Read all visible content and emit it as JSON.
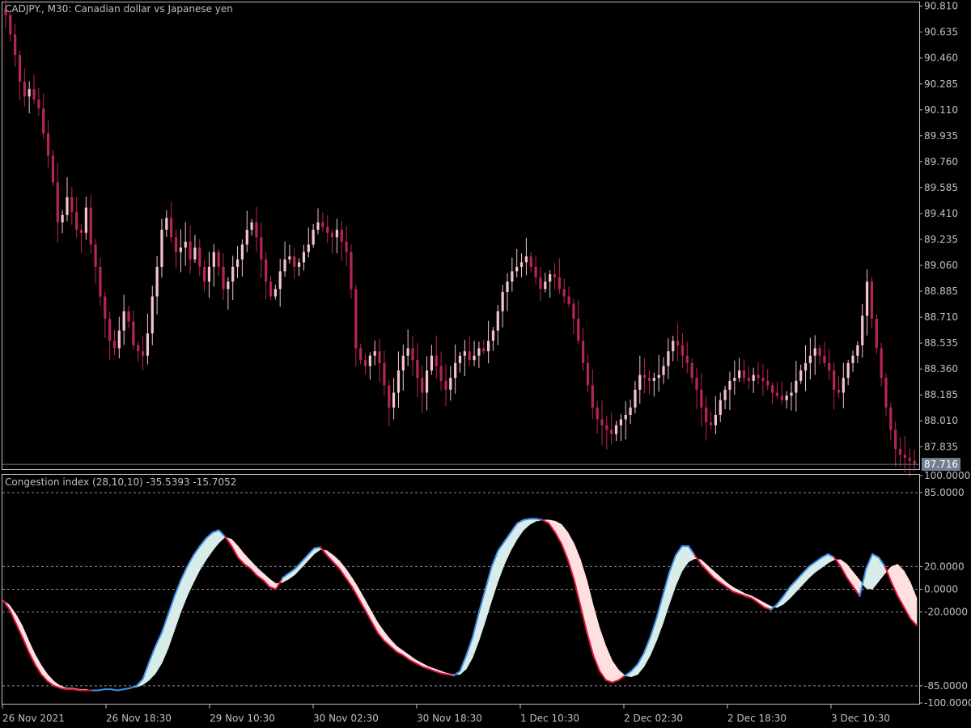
{
  "colors": {
    "background": "#000000",
    "axis_line": "#c0c0c0",
    "text": "#c0c0c0",
    "bull_candle": "#f2c5cc",
    "bear_candle": "#b8264f",
    "grid_dash": "#c0c0c0",
    "current_price_line": "#6f7f9f",
    "current_price_label_bg": "#708090",
    "up_line": "#3f8fe6",
    "down_line": "#dc143c",
    "up_fill": "#d8ece9",
    "down_fill": "#ffe0e0"
  },
  "price_panel": {
    "symbol_label": "CADJPY., M30:  Canadian dollar vs Japanese yen",
    "current_price": "87.716",
    "ticks": [
      "90.810",
      "90.635",
      "90.460",
      "90.285",
      "90.110",
      "89.935",
      "89.760",
      "89.585",
      "89.410",
      "89.235",
      "89.060",
      "88.885",
      "88.710",
      "88.535",
      "88.360",
      "88.185",
      "88.010",
      "87.835"
    ]
  },
  "indicator_panel": {
    "label": "Congestion index (28,10,10) -35.5393 -15.7052",
    "ticks": [
      "100.0000",
      "85.0000",
      "20.0000",
      "0.0000",
      "-20.0000",
      "-85.0000",
      "-100.0000"
    ],
    "levels": [
      "85.0000",
      "20.0000",
      "0.0000",
      "-20.0000",
      "-85.0000"
    ]
  },
  "time_axis": {
    "labels": [
      "26 Nov 2021",
      "26 Nov 18:30",
      "29 Nov 10:30",
      "30 Nov 02:30",
      "30 Nov 18:30",
      "1 Dec 10:30",
      "2 Dec 02:30",
      "2 Dec 18:30",
      "3 Dec 10:30"
    ]
  },
  "chart_data": [
    {
      "type": "candlestick",
      "title": "CADJPY., M30:  Canadian dollar vs Japanese yen",
      "ylim": [
        87.7,
        90.83
      ],
      "x_start_label": "26 Nov 2021",
      "closes": [
        90.75,
        90.62,
        90.48,
        90.3,
        90.2,
        90.25,
        90.18,
        90.12,
        89.95,
        89.8,
        89.62,
        89.35,
        89.4,
        89.52,
        89.42,
        89.3,
        89.28,
        89.45,
        89.2,
        89.05,
        88.85,
        88.7,
        88.55,
        88.5,
        88.62,
        88.75,
        88.68,
        88.52,
        88.48,
        88.45,
        88.6,
        88.85,
        89.05,
        89.3,
        89.38,
        89.25,
        89.15,
        89.18,
        89.22,
        89.1,
        89.18,
        89.05,
        88.95,
        89.05,
        89.15,
        89.05,
        88.9,
        88.95,
        89.05,
        89.1,
        89.2,
        89.3,
        89.35,
        89.25,
        89.1,
        88.95,
        88.85,
        88.9,
        89.02,
        89.1,
        89.12,
        89.05,
        89.08,
        89.15,
        89.2,
        89.3,
        89.35,
        89.32,
        89.28,
        89.25,
        89.3,
        89.22,
        89.15,
        88.9,
        88.5,
        88.42,
        88.38,
        88.45,
        88.48,
        88.4,
        88.25,
        88.1,
        88.2,
        88.35,
        88.45,
        88.5,
        88.42,
        88.3,
        88.2,
        88.35,
        88.45,
        88.38,
        88.28,
        88.22,
        88.3,
        88.4,
        88.45,
        88.48,
        88.42,
        88.45,
        88.5,
        88.48,
        88.55,
        88.62,
        88.75,
        88.88,
        88.95,
        89.02,
        89.05,
        89.08,
        89.12,
        89.05,
        88.98,
        88.9,
        88.95,
        89.0,
        88.98,
        88.9,
        88.85,
        88.8,
        88.7,
        88.55,
        88.4,
        88.25,
        88.1,
        88.02,
        87.98,
        87.95,
        87.92,
        87.98,
        88.02,
        88.05,
        88.1,
        88.22,
        88.32,
        88.3,
        88.28,
        88.3,
        88.32,
        88.38,
        88.48,
        88.55,
        88.52,
        88.45,
        88.4,
        88.3,
        88.22,
        88.1,
        88.0,
        87.98,
        88.05,
        88.15,
        88.22,
        88.28,
        88.3,
        88.35,
        88.3,
        88.28,
        88.32,
        88.3,
        88.28,
        88.25,
        88.2,
        88.18,
        88.15,
        88.18,
        88.2,
        88.28,
        88.35,
        88.4,
        88.45,
        88.5,
        88.45,
        88.4,
        88.35,
        88.22,
        88.2,
        88.3,
        88.4,
        88.45,
        88.52,
        88.72,
        88.95,
        88.7,
        88.5,
        88.3,
        88.1,
        87.95,
        87.82,
        87.78,
        87.76,
        87.74,
        87.72
      ]
    },
    {
      "type": "area",
      "title": "Congestion index (28,10,10) -35.5393 -15.7052",
      "ylim": [
        -100,
        100
      ],
      "reference_levels": [
        85,
        20,
        0,
        -20,
        -85
      ],
      "series": [
        {
          "name": "",
          "values": [
            -10,
            -18,
            -30,
            -42,
            -55,
            -66,
            -75,
            -81,
            -85,
            -87,
            -88,
            -88,
            -89,
            -89,
            -89,
            -89,
            -88,
            -88,
            -89,
            -88,
            -87,
            -85,
            -79,
            -64,
            -50,
            -38,
            -22,
            -6,
            8,
            20,
            30,
            38,
            45,
            50,
            52,
            46,
            38,
            28,
            22,
            18,
            12,
            8,
            2,
            0,
            10,
            14,
            18,
            24,
            30,
            36,
            37,
            30,
            24,
            18,
            10,
            2,
            -8,
            -18,
            -28,
            -38,
            -45,
            -50,
            -55,
            -58,
            -62,
            -65,
            -68,
            -70,
            -72,
            -74,
            -75,
            -76,
            -72,
            -58,
            -42,
            -20,
            0,
            20,
            34,
            42,
            50,
            58,
            61,
            62,
            62,
            61,
            58,
            50,
            40,
            26,
            8,
            -15,
            -38,
            -58,
            -72,
            -80,
            -82,
            -80,
            -76,
            -72,
            -66,
            -56,
            -42,
            -25,
            -5,
            15,
            30,
            38,
            38,
            30,
            22,
            16,
            10,
            6,
            2,
            -2,
            -4,
            -6,
            -8,
            -12,
            -16,
            -18,
            -13,
            -6,
            2,
            8,
            14,
            20,
            24,
            28,
            31,
            28,
            20,
            10,
            2,
            -6,
            18,
            31,
            28,
            20,
            6,
            -6,
            -16,
            -26,
            -32
          ]
        },
        {
          "name": "",
          "values": [
            -10,
            -14,
            -22,
            -32,
            -45,
            -57,
            -67,
            -75,
            -81,
            -85,
            -87,
            -87,
            -88,
            -88,
            -89,
            -89,
            -88,
            -88,
            -89,
            -88,
            -87,
            -86,
            -84,
            -80,
            -74,
            -65,
            -52,
            -36,
            -20,
            -6,
            6,
            17,
            26,
            34,
            41,
            46,
            44,
            38,
            31,
            25,
            19,
            14,
            9,
            5,
            6,
            9,
            13,
            19,
            25,
            31,
            35,
            34,
            30,
            25,
            18,
            10,
            1,
            -9,
            -19,
            -29,
            -37,
            -44,
            -50,
            -54,
            -58,
            -62,
            -65,
            -68,
            -70,
            -72,
            -74,
            -75,
            -75,
            -70,
            -60,
            -45,
            -28,
            -10,
            7,
            22,
            34,
            44,
            52,
            57,
            60,
            61,
            61,
            60,
            57,
            50,
            40,
            26,
            8,
            -14,
            -34,
            -50,
            -63,
            -71,
            -76,
            -77,
            -75,
            -68,
            -58,
            -45,
            -30,
            -13,
            3,
            16,
            24,
            27,
            26,
            21,
            16,
            11,
            6,
            2,
            -1,
            -4,
            -6,
            -9,
            -12,
            -15,
            -16,
            -13,
            -8,
            -2,
            4,
            10,
            15,
            19,
            23,
            26,
            26,
            22,
            15,
            8,
            1,
            0,
            7,
            14,
            20,
            22,
            16,
            6,
            -8,
            -20
          ]
        }
      ]
    }
  ]
}
